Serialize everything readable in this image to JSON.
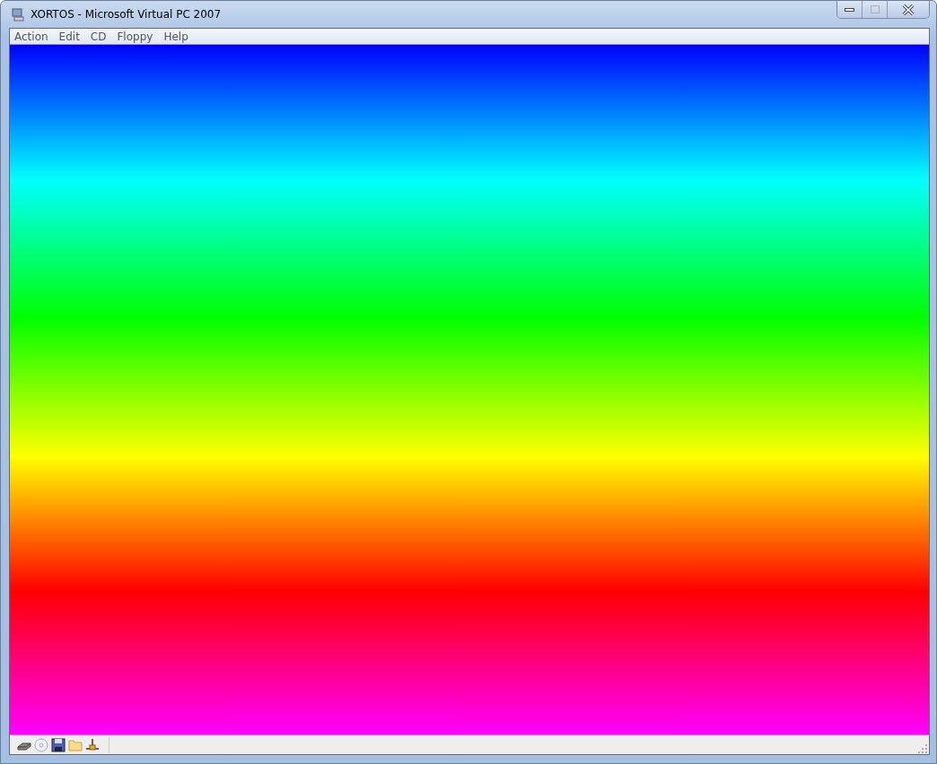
{
  "window": {
    "title": "XORTOS - Microsoft Virtual PC 2007"
  },
  "window_buttons": [
    {
      "kind": "minimize",
      "disabled": false
    },
    {
      "kind": "maximize",
      "disabled": true
    },
    {
      "kind": "close",
      "disabled": false
    }
  ],
  "menu": [
    "Action",
    "Edit",
    "CD",
    "Floppy",
    "Help"
  ],
  "status_bar": {
    "icons": [
      {
        "kind": "disk"
      },
      {
        "kind": "cd"
      },
      {
        "kind": "floppy"
      },
      {
        "kind": "folder"
      },
      {
        "kind": "network"
      }
    ]
  }
}
